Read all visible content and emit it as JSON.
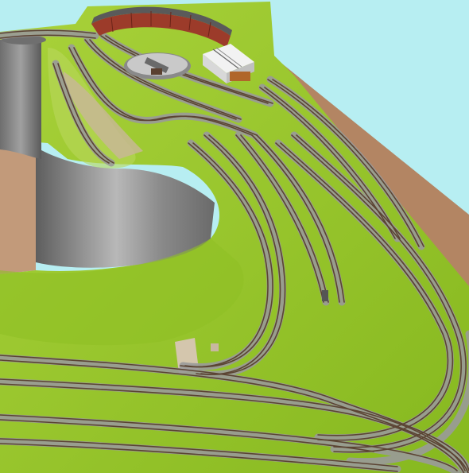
{
  "scene": {
    "subject": "model-railway-layout-3d-render",
    "colors": {
      "sky": "#b7eef2",
      "grass": "#8fbf2a",
      "grass_light": "#a7cf34",
      "grass_dark": "#6f9a1e",
      "board_edge": "#b07a55",
      "board_floor": "#c49a78",
      "pit_wall": "#7a7a7a",
      "pit_wall_light": "#a9a9a9",
      "ballast": "#9a9a9a",
      "rail": "#5b4433",
      "engine_shed_brick": "#9c3b2a",
      "turntable": "#c9c9c9",
      "building_white": "#e8e8e8"
    },
    "icons": [
      "roundhouse-icon",
      "turntable-icon",
      "engine-shed-icon"
    ]
  }
}
